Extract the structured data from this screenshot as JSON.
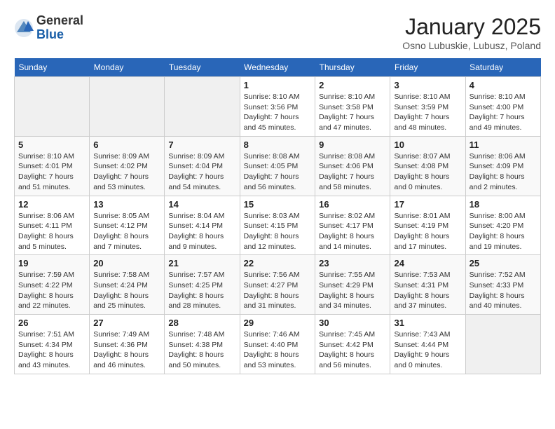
{
  "logo": {
    "general": "General",
    "blue": "Blue"
  },
  "title": "January 2025",
  "location": "Osno Lubuskie, Lubusz, Poland",
  "days_of_week": [
    "Sunday",
    "Monday",
    "Tuesday",
    "Wednesday",
    "Thursday",
    "Friday",
    "Saturday"
  ],
  "weeks": [
    [
      {
        "day": "",
        "info": ""
      },
      {
        "day": "",
        "info": ""
      },
      {
        "day": "",
        "info": ""
      },
      {
        "day": "1",
        "info": "Sunrise: 8:10 AM\nSunset: 3:56 PM\nDaylight: 7 hours and 45 minutes."
      },
      {
        "day": "2",
        "info": "Sunrise: 8:10 AM\nSunset: 3:58 PM\nDaylight: 7 hours and 47 minutes."
      },
      {
        "day": "3",
        "info": "Sunrise: 8:10 AM\nSunset: 3:59 PM\nDaylight: 7 hours and 48 minutes."
      },
      {
        "day": "4",
        "info": "Sunrise: 8:10 AM\nSunset: 4:00 PM\nDaylight: 7 hours and 49 minutes."
      }
    ],
    [
      {
        "day": "5",
        "info": "Sunrise: 8:10 AM\nSunset: 4:01 PM\nDaylight: 7 hours and 51 minutes."
      },
      {
        "day": "6",
        "info": "Sunrise: 8:09 AM\nSunset: 4:02 PM\nDaylight: 7 hours and 53 minutes."
      },
      {
        "day": "7",
        "info": "Sunrise: 8:09 AM\nSunset: 4:04 PM\nDaylight: 7 hours and 54 minutes."
      },
      {
        "day": "8",
        "info": "Sunrise: 8:08 AM\nSunset: 4:05 PM\nDaylight: 7 hours and 56 minutes."
      },
      {
        "day": "9",
        "info": "Sunrise: 8:08 AM\nSunset: 4:06 PM\nDaylight: 7 hours and 58 minutes."
      },
      {
        "day": "10",
        "info": "Sunrise: 8:07 AM\nSunset: 4:08 PM\nDaylight: 8 hours and 0 minutes."
      },
      {
        "day": "11",
        "info": "Sunrise: 8:06 AM\nSunset: 4:09 PM\nDaylight: 8 hours and 2 minutes."
      }
    ],
    [
      {
        "day": "12",
        "info": "Sunrise: 8:06 AM\nSunset: 4:11 PM\nDaylight: 8 hours and 5 minutes."
      },
      {
        "day": "13",
        "info": "Sunrise: 8:05 AM\nSunset: 4:12 PM\nDaylight: 8 hours and 7 minutes."
      },
      {
        "day": "14",
        "info": "Sunrise: 8:04 AM\nSunset: 4:14 PM\nDaylight: 8 hours and 9 minutes."
      },
      {
        "day": "15",
        "info": "Sunrise: 8:03 AM\nSunset: 4:15 PM\nDaylight: 8 hours and 12 minutes."
      },
      {
        "day": "16",
        "info": "Sunrise: 8:02 AM\nSunset: 4:17 PM\nDaylight: 8 hours and 14 minutes."
      },
      {
        "day": "17",
        "info": "Sunrise: 8:01 AM\nSunset: 4:19 PM\nDaylight: 8 hours and 17 minutes."
      },
      {
        "day": "18",
        "info": "Sunrise: 8:00 AM\nSunset: 4:20 PM\nDaylight: 8 hours and 19 minutes."
      }
    ],
    [
      {
        "day": "19",
        "info": "Sunrise: 7:59 AM\nSunset: 4:22 PM\nDaylight: 8 hours and 22 minutes."
      },
      {
        "day": "20",
        "info": "Sunrise: 7:58 AM\nSunset: 4:24 PM\nDaylight: 8 hours and 25 minutes."
      },
      {
        "day": "21",
        "info": "Sunrise: 7:57 AM\nSunset: 4:25 PM\nDaylight: 8 hours and 28 minutes."
      },
      {
        "day": "22",
        "info": "Sunrise: 7:56 AM\nSunset: 4:27 PM\nDaylight: 8 hours and 31 minutes."
      },
      {
        "day": "23",
        "info": "Sunrise: 7:55 AM\nSunset: 4:29 PM\nDaylight: 8 hours and 34 minutes."
      },
      {
        "day": "24",
        "info": "Sunrise: 7:53 AM\nSunset: 4:31 PM\nDaylight: 8 hours and 37 minutes."
      },
      {
        "day": "25",
        "info": "Sunrise: 7:52 AM\nSunset: 4:33 PM\nDaylight: 8 hours and 40 minutes."
      }
    ],
    [
      {
        "day": "26",
        "info": "Sunrise: 7:51 AM\nSunset: 4:34 PM\nDaylight: 8 hours and 43 minutes."
      },
      {
        "day": "27",
        "info": "Sunrise: 7:49 AM\nSunset: 4:36 PM\nDaylight: 8 hours and 46 minutes."
      },
      {
        "day": "28",
        "info": "Sunrise: 7:48 AM\nSunset: 4:38 PM\nDaylight: 8 hours and 50 minutes."
      },
      {
        "day": "29",
        "info": "Sunrise: 7:46 AM\nSunset: 4:40 PM\nDaylight: 8 hours and 53 minutes."
      },
      {
        "day": "30",
        "info": "Sunrise: 7:45 AM\nSunset: 4:42 PM\nDaylight: 8 hours and 56 minutes."
      },
      {
        "day": "31",
        "info": "Sunrise: 7:43 AM\nSunset: 4:44 PM\nDaylight: 9 hours and 0 minutes."
      },
      {
        "day": "",
        "info": ""
      }
    ]
  ]
}
